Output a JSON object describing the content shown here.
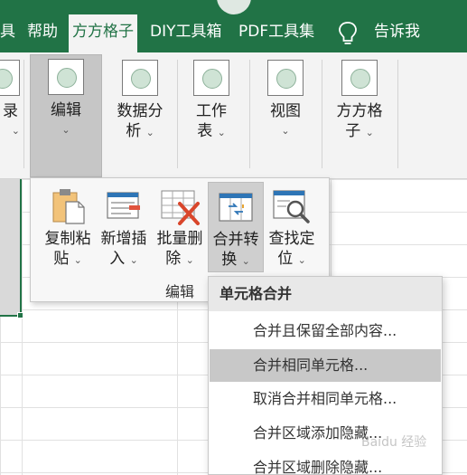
{
  "tabs": [
    {
      "label": "具"
    },
    {
      "label": "帮助"
    },
    {
      "label": "方方格子",
      "active": true
    },
    {
      "label": "DIY工具箱"
    },
    {
      "label": "PDF工具集"
    },
    {
      "label": "告诉我"
    }
  ],
  "ribbon": {
    "buttons": [
      {
        "label_l1": "录",
        "label_l2": ""
      },
      {
        "label_l1": "编辑",
        "label_l2": ""
      },
      {
        "label_l1": "数据分",
        "label_l2": "析"
      },
      {
        "label_l1": "工作",
        "label_l2": "表"
      },
      {
        "label_l1": "视图",
        "label_l2": ""
      },
      {
        "label_l1": "方方格",
        "label_l2": "子"
      }
    ]
  },
  "edit_group": {
    "title": "编辑",
    "buttons": [
      {
        "label_l1": "复制粘",
        "label_l2": "贴"
      },
      {
        "label_l1": "新增插",
        "label_l2": "入"
      },
      {
        "label_l1": "批量删",
        "label_l2": "除"
      },
      {
        "label_l1": "合并转",
        "label_l2": "换"
      },
      {
        "label_l1": "查找定",
        "label_l2": "位"
      }
    ]
  },
  "submenu": {
    "header": "单元格合并",
    "items": [
      {
        "label": "合并且保留全部内容..."
      },
      {
        "label": "合并相同单元格..."
      },
      {
        "label": "取消合并相同单元格..."
      },
      {
        "label": "合并区域添加隐藏..."
      },
      {
        "label": "合并区域删除隐藏..."
      }
    ]
  },
  "chevron": "⌄",
  "watermark": "Baidu 经验",
  "colors": {
    "accent": "#217346"
  }
}
